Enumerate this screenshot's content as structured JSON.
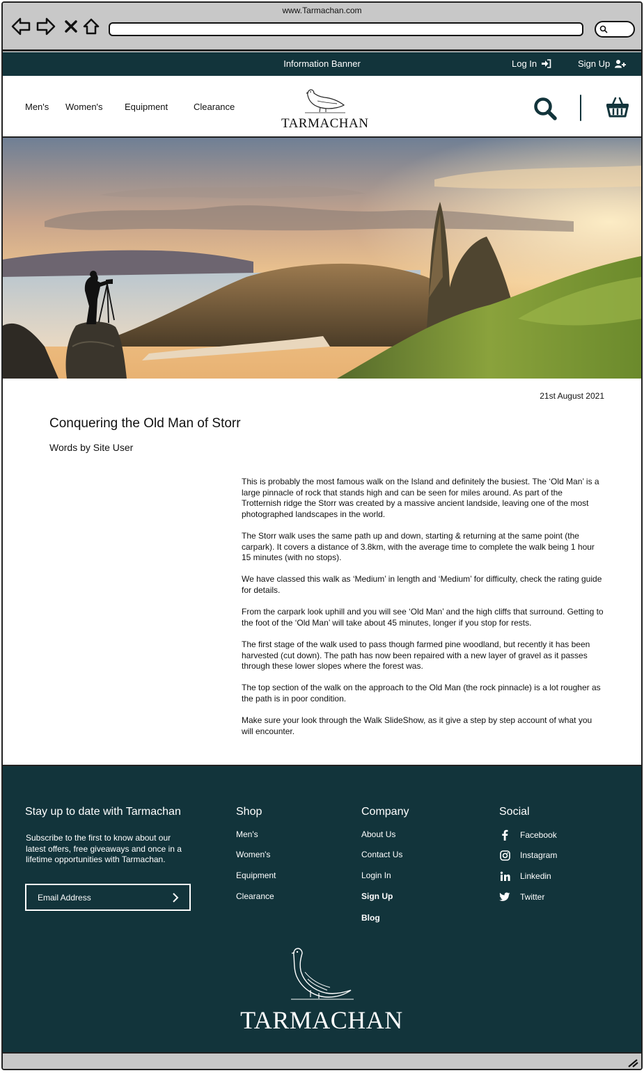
{
  "browser": {
    "title": "www.Tarmachan.com",
    "url": ""
  },
  "banner": {
    "info": "Information Banner",
    "login_label": "Log In",
    "signup_label": "Sign Up",
    "bg_color": "#12343b"
  },
  "header": {
    "nav": [
      "Men's",
      "Women's",
      "Equipment",
      "Clearance"
    ],
    "logo_text": "TARMACHAN",
    "icons": [
      "search-icon",
      "basket-icon"
    ]
  },
  "article": {
    "date": "21st August 2021",
    "title": "Conquering the Old Man of Storr",
    "byline": "Words by Site User",
    "paragraphs": [
      "This is probably the most famous walk on the Island and definitely the busiest. The ‘Old Man’ is a large pinnacle of rock that stands high and can be seen for miles around. As part of the Trotternish ridge the Storr was created by a massive ancient landside, leaving one of the most photographed landscapes in the world.",
      "The Storr walk uses the same path up and down, starting & returning at the same point (the carpark). It covers a distance of 3.8km, with the average time to complete the walk being 1 hour 15 minutes (with no stops).",
      "We have classed this walk as ‘Medium’ in length and ‘Medium’ for difficulty, check the rating guide for details.",
      "From the carpark look uphill and you will see ‘Old Man’ and the high cliffs that surround. Getting to the foot of the ‘Old Man’ will take about 45 minutes, longer if you stop for rests.",
      "The first stage of the walk used to pass though farmed pine woodland, but recently it has been harvested (cut down). The path has now been repaired with a new layer of gravel as it passes through these lower slopes where the forest was.",
      "The top section of the walk on the approach to the Old Man (the rock pinnacle) is a lot rougher as the path is in poor condition.",
      "Make sure your look through the Walk SlideShow, as it give a step by step account of what you will encounter."
    ]
  },
  "footer": {
    "newsletter_heading": "Stay up to date with Tarmachan",
    "newsletter_text": "Subscribe to the first to know about our latest offers, free giveaways and once in a lifetime opportunities with Tarmachan.",
    "email_placeholder": "Email Address",
    "shop_heading": "Shop",
    "shop_links": [
      "Men's",
      "Women's",
      "Equipment",
      "Clearance"
    ],
    "company_heading": "Company",
    "company_links": [
      "About Us",
      "Contact Us",
      "Login In",
      "Sign Up",
      "Blog"
    ],
    "social_heading": "Social",
    "social_links": [
      {
        "label": "Facebook",
        "icon": "facebook-icon"
      },
      {
        "label": "Instagram",
        "icon": "instagram-icon"
      },
      {
        "label": "Linkedin",
        "icon": "linkedin-icon"
      },
      {
        "label": "Twitter",
        "icon": "twitter-icon"
      }
    ],
    "logo_text": "TARMACHAN"
  }
}
